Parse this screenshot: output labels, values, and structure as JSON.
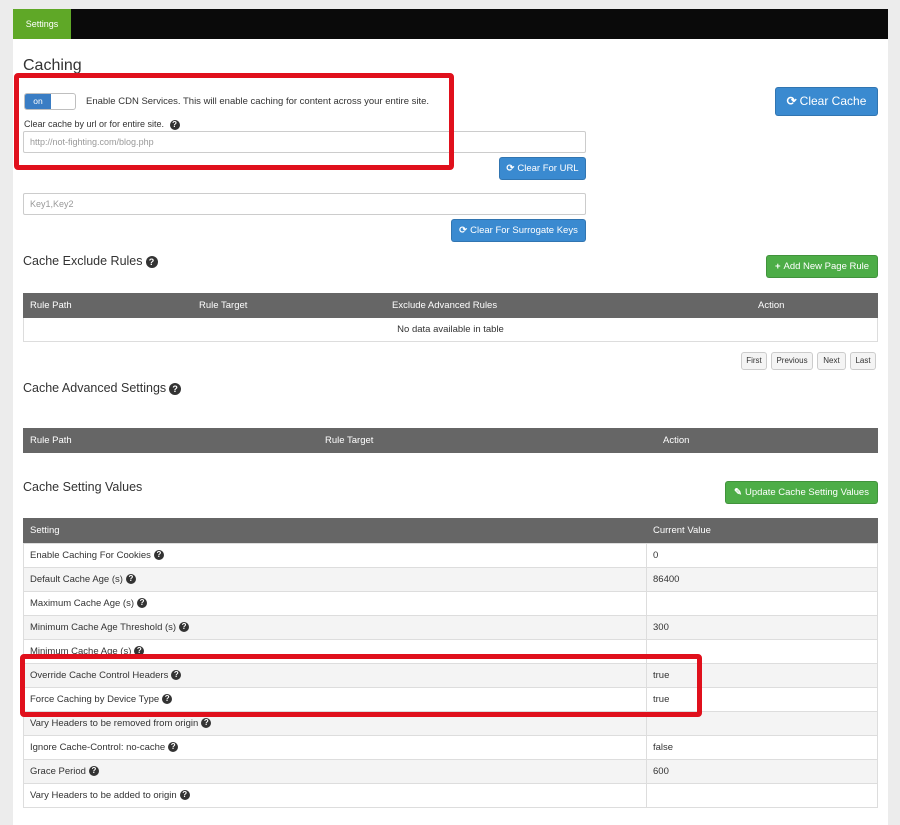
{
  "top_tab": "Settings",
  "page_title": "Caching",
  "cdn_toggle": {
    "state": "on",
    "label": "Enable CDN Services. This will enable caching for content across your entire site."
  },
  "clear_cache_button": "Clear Cache",
  "clear_url": {
    "label": "Clear cache by url or for entire site.",
    "placeholder": "http://not-fighting.com/blog.php",
    "button": "Clear For URL"
  },
  "surrogate": {
    "placeholder": "Key1,Key2",
    "button": "Clear For Surrogate Keys"
  },
  "exclude_rules": {
    "title": "Cache Exclude Rules",
    "add_button": "Add New Page Rule",
    "columns": [
      "Rule Path",
      "Rule Target",
      "Exclude Advanced Rules",
      "Action"
    ],
    "empty_text": "No data available in table"
  },
  "pagination": [
    "First",
    "Previous",
    "Next",
    "Last"
  ],
  "advanced": {
    "title": "Cache Advanced Settings",
    "columns": [
      "Rule Path",
      "Rule Target",
      "Action"
    ]
  },
  "values": {
    "title": "Cache Setting Values",
    "update_button": "Update Cache Setting Values",
    "columns": [
      "Setting",
      "Current Value"
    ],
    "rows": [
      {
        "setting": "Enable Caching For Cookies",
        "value": "0"
      },
      {
        "setting": "Default Cache Age (s)",
        "value": "86400"
      },
      {
        "setting": "Maximum Cache Age (s)",
        "value": ""
      },
      {
        "setting": "Minimum Cache Age Threshold (s)",
        "value": "300"
      },
      {
        "setting": "Minimum Cache Age (s)",
        "value": ""
      },
      {
        "setting": "Override Cache Control Headers",
        "value": "true"
      },
      {
        "setting": "Force Caching by Device Type",
        "value": "true"
      },
      {
        "setting": "Vary Headers to be removed from origin",
        "value": ""
      },
      {
        "setting": "Ignore Cache-Control: no-cache",
        "value": "false"
      },
      {
        "setting": "Grace Period",
        "value": "600"
      },
      {
        "setting": "Vary Headers to be added to origin",
        "value": ""
      }
    ]
  },
  "colors": {
    "highlight": "#e0101c",
    "primary": "#3a8ad0",
    "success": "#4dad47",
    "tab_active": "#5fa827"
  }
}
